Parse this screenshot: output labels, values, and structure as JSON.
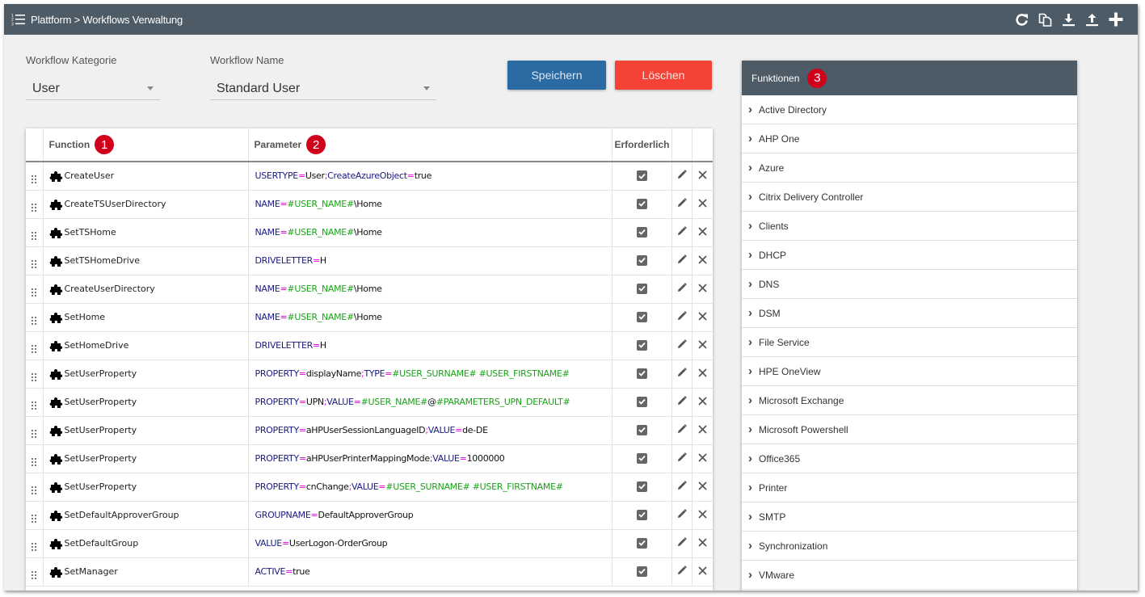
{
  "header": {
    "breadcrumb": "Plattform > Workflows Verwaltung",
    "toolbar": [
      {
        "name": "refresh",
        "icon": "refresh-icon"
      },
      {
        "name": "copy",
        "icon": "copy-icon"
      },
      {
        "name": "download",
        "icon": "download-icon"
      },
      {
        "name": "upload",
        "icon": "upload-icon"
      },
      {
        "name": "add",
        "icon": "plus-icon"
      }
    ]
  },
  "form": {
    "category": {
      "label": "Workflow Kategorie",
      "value": "User"
    },
    "name": {
      "label": "Workflow Name",
      "value": "Standard User"
    },
    "save_label": "Speichern",
    "delete_label": "Löschen"
  },
  "colors": {
    "header_bg": "#4c5b66",
    "save": "#2b6aa3",
    "delete": "#f44336",
    "badge": "#d0021b",
    "param_key": "#1a1a80",
    "param_operator": "#e000e0",
    "param_variable": "#1aa31a"
  },
  "table": {
    "columns": {
      "function": "Function",
      "parameter": "Parameter",
      "required": "Erforderlich"
    },
    "badges": {
      "function": "1",
      "parameter": "2"
    },
    "rows": [
      {
        "function": "CreateUser",
        "parameter": "USERTYPE=User;CreateAzureObject=true",
        "required": true
      },
      {
        "function": "CreateTSUserDirectory",
        "parameter": "NAME=#USER_NAME#\\Home",
        "required": true
      },
      {
        "function": "SetTSHome",
        "parameter": "NAME=#USER_NAME#\\Home",
        "required": true
      },
      {
        "function": "SetTSHomeDrive",
        "parameter": "DRIVELETTER=H",
        "required": true
      },
      {
        "function": "CreateUserDirectory",
        "parameter": "NAME=#USER_NAME#\\Home",
        "required": true
      },
      {
        "function": "SetHome",
        "parameter": "NAME=#USER_NAME#\\Home",
        "required": true
      },
      {
        "function": "SetHomeDrive",
        "parameter": "DRIVELETTER=H",
        "required": true
      },
      {
        "function": "SetUserProperty",
        "parameter": "PROPERTY=displayName;TYPE=#USER_SURNAME# #USER_FIRSTNAME#",
        "required": true
      },
      {
        "function": "SetUserProperty",
        "parameter": "PROPERTY=UPN;VALUE=#USER_NAME#@#PARAMETERS_UPN_DEFAULT#",
        "required": true
      },
      {
        "function": "SetUserProperty",
        "parameter": "PROPERTY=aHPUserSessionLanguageID;VALUE=de-DE",
        "required": true
      },
      {
        "function": "SetUserProperty",
        "parameter": "PROPERTY=aHPUserPrinterMappingMode;VALUE=1000000",
        "required": true
      },
      {
        "function": "SetUserProperty",
        "parameter": "PROPERTY=cnChange;VALUE=#USER_SURNAME# #USER_FIRSTNAME#",
        "required": true
      },
      {
        "function": "SetDefaultApproverGroup",
        "parameter": "GROUPNAME=DefaultApproverGroup",
        "required": true
      },
      {
        "function": "SetDefaultGroup",
        "parameter": "VALUE=UserLogon-OrderGroup",
        "required": true
      },
      {
        "function": "SetManager",
        "parameter": "ACTIVE=true",
        "required": true
      }
    ]
  },
  "functions_panel": {
    "title": "Funktionen",
    "badge": "3",
    "items": [
      "Active Directory",
      "AHP One",
      "Azure",
      "Citrix Delivery Controller",
      "Clients",
      "DHCP",
      "DNS",
      "DSM",
      "File Service",
      "HPE OneView",
      "Microsoft Exchange",
      "Microsoft Powershell",
      "Office365",
      "Printer",
      "SMTP",
      "Synchronization",
      "VMware"
    ]
  }
}
